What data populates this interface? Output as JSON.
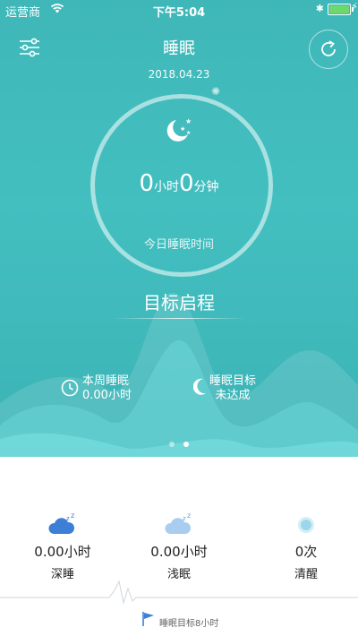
{
  "status_bar": {
    "carrier": "运营商",
    "time": "下午5:04"
  },
  "header": {
    "title": "睡眠",
    "date": "2018.04.23"
  },
  "ring": {
    "hours": "0",
    "hour_unit": "小时",
    "minutes": "0",
    "minute_unit": "分钟",
    "caption": "今日睡眠时间"
  },
  "goal_button": "目标启程",
  "weekly": {
    "label": "本周睡眠",
    "value": "0.00小时"
  },
  "target": {
    "label": "睡眠目标",
    "value": "未达成"
  },
  "pager": {
    "count": 2,
    "active": 2
  },
  "stats": [
    {
      "value": "0.00小时",
      "name": "深睡",
      "icon": "deep-sleep-cloud-icon",
      "color": "#3d7fd6"
    },
    {
      "value": "0.00小时",
      "name": "浅眠",
      "icon": "light-sleep-cloud-icon",
      "color": "#a8cdf0"
    },
    {
      "value": "0次",
      "name": "清醒",
      "icon": "awake-circle-icon",
      "color": "#9dd6ea"
    }
  ],
  "goal_flag": {
    "label": "睡眠目标8小时",
    "icon": "flag-icon",
    "color": "#3d7fd6"
  },
  "theme": {
    "hero": "#43bfc0",
    "white": "#ffffff"
  }
}
